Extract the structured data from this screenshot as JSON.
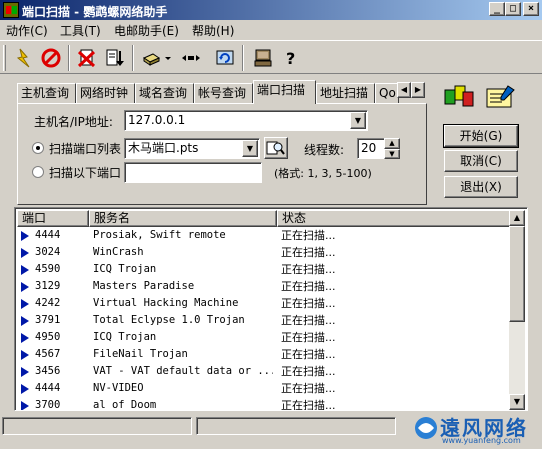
{
  "window": {
    "title": "端口扫描 - 鹦鹉螺网络助手"
  },
  "menu": {
    "items": [
      "动作(C)",
      "工具(T)",
      "电邮助手(E)",
      "帮助(H)"
    ]
  },
  "tabs": [
    {
      "label": "主机查询",
      "active": false
    },
    {
      "label": "网络时钟",
      "active": false
    },
    {
      "label": "域名查询",
      "active": false
    },
    {
      "label": "帐号查询",
      "active": false
    },
    {
      "label": "端口扫描",
      "active": true
    },
    {
      "label": "地址扫描",
      "active": false
    },
    {
      "label": "Qo",
      "active": false
    }
  ],
  "form": {
    "host_label": "主机名/IP地址:",
    "host_value": "127.0.0.1",
    "scan_list_label": "扫描端口列表",
    "scan_list_value": "木马端口.pts",
    "threads_label": "线程数:",
    "threads_value": "20",
    "scan_ports_label": "扫描以下端口",
    "scan_ports_value": "",
    "format_hint": "(格式: 1, 3, 5-100)"
  },
  "buttons": {
    "start": "开始(G)",
    "cancel": "取消(C)",
    "exit": "退出(X)"
  },
  "list": {
    "columns": [
      "端口",
      "服务名",
      "状态"
    ],
    "rows": [
      {
        "port": "4444",
        "service": "Prosiak, Swift remote",
        "status": "正在扫描..."
      },
      {
        "port": "3024",
        "service": "WinCrash",
        "status": "正在扫描..."
      },
      {
        "port": "4590",
        "service": "ICQ Trojan",
        "status": "正在扫描..."
      },
      {
        "port": "3129",
        "service": "Masters Paradise",
        "status": "正在扫描..."
      },
      {
        "port": "4242",
        "service": "Virtual Hacking Machine",
        "status": "正在扫描..."
      },
      {
        "port": "3791",
        "service": "Total Eclypse 1.0 Trojan",
        "status": "正在扫描..."
      },
      {
        "port": "4950",
        "service": "ICQ Trojan",
        "status": "正在扫描..."
      },
      {
        "port": "4567",
        "service": "FileNail Trojan",
        "status": "正在扫描..."
      },
      {
        "port": "3456",
        "service": "VAT - VAT default data or ...",
        "status": "正在扫描..."
      },
      {
        "port": "4444",
        "service": "NV-VIDEO",
        "status": "正在扫描..."
      },
      {
        "port": "3700",
        "service": "al of Doom",
        "status": "正在扫描..."
      }
    ]
  },
  "watermark": {
    "text": "遠风网络",
    "url": "www.yuanfeng.com"
  },
  "colors": {
    "titlebar_start": "#0a246a",
    "titlebar_end": "#a6caf0",
    "row_arrow": "#0018a8"
  }
}
